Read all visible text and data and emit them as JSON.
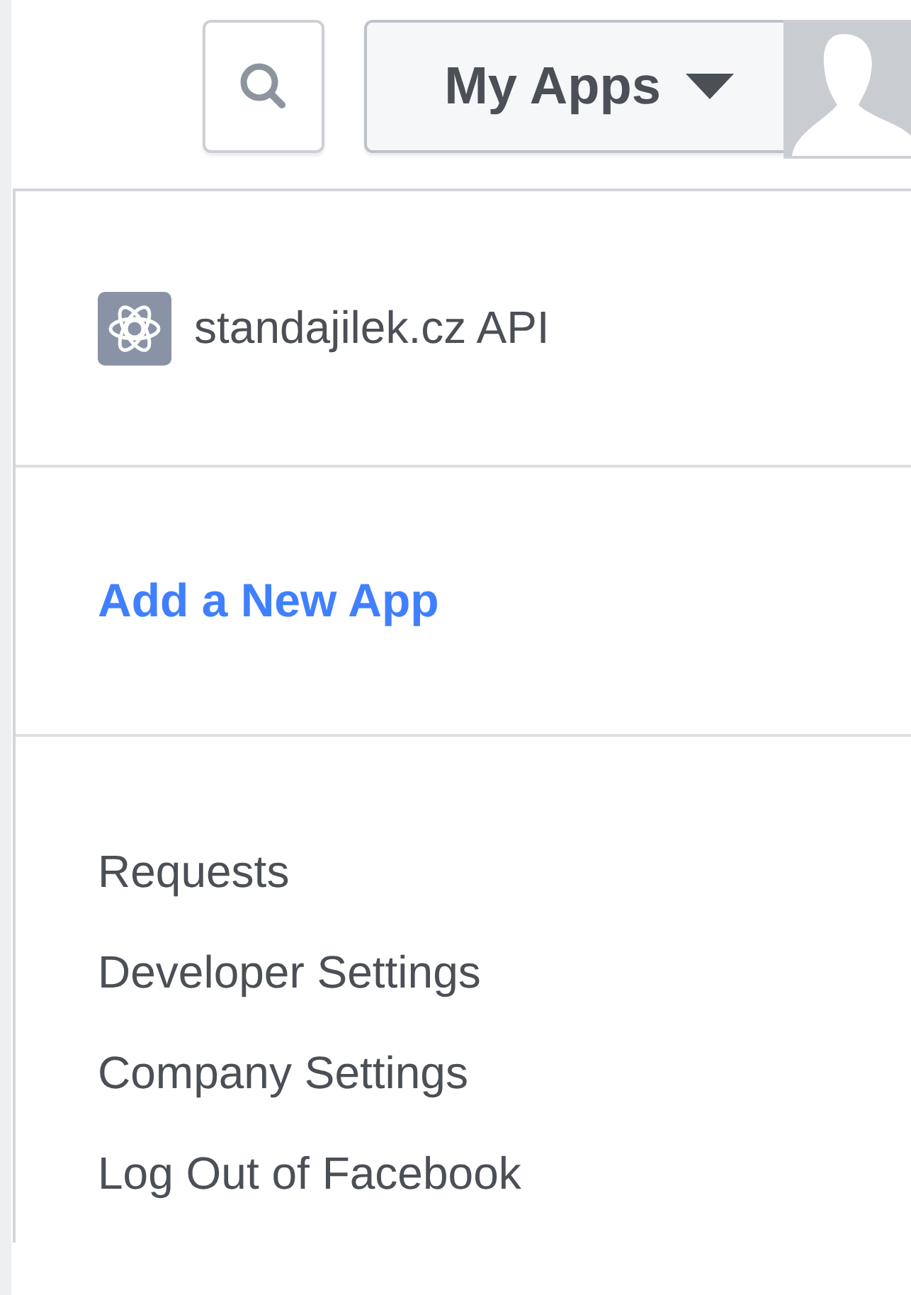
{
  "header": {
    "menu_button": {
      "label": "My Apps",
      "expanded": true
    }
  },
  "dropdown": {
    "apps": [
      {
        "name": "standajilek.cz API"
      }
    ],
    "add_app": "Add a New App",
    "links": [
      "Requests",
      "Developer Settings",
      "Company Settings",
      "Log Out of Facebook"
    ]
  }
}
